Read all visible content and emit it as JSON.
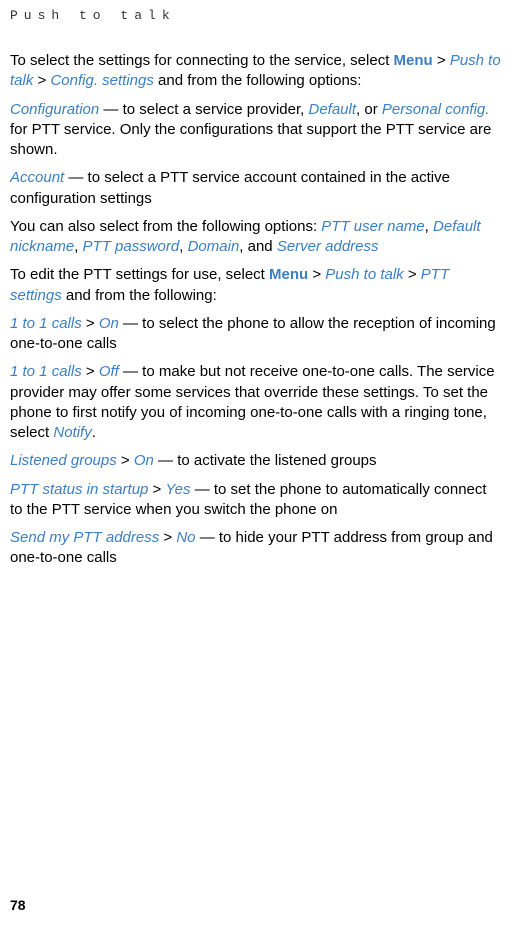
{
  "header": {
    "title": "Push to talk"
  },
  "content": {
    "p1_a": "To select the settings for connecting to the service, select ",
    "p1_menu": "Menu",
    "p1_sep1": " > ",
    "p1_ptt": "Push to talk",
    "p1_sep2": " > ",
    "p1_config": "Config. settings",
    "p1_b": " and from the following options:",
    "p2_config": "Configuration",
    "p2_a": " — to select a service provider, ",
    "p2_default": "Default",
    "p2_b": ", or ",
    "p2_personal": "Personal config.",
    "p2_c": " for PTT service. Only the configurations that support the PTT service are shown.",
    "p3_account": "Account",
    "p3_a": " — to select a PTT service account contained in the active configuration settings",
    "p4_a": "You can also select from the following options: ",
    "p4_username": "PTT user name",
    "p4_sep1": ", ",
    "p4_nickname": "Default nickname",
    "p4_sep2": ", ",
    "p4_password": "PTT password",
    "p4_sep3": ", ",
    "p4_domain": "Domain",
    "p4_sep4": ", and ",
    "p4_server": "Server address",
    "p5_a": "To edit the PTT settings for use, select ",
    "p5_menu": "Menu",
    "p5_sep1": " > ",
    "p5_ptt": "Push to talk",
    "p5_sep2": " > ",
    "p5_settings": "PTT settings",
    "p5_b": " and from the following:",
    "p6_1to1": "1 to 1 calls",
    "p6_sep1": " > ",
    "p6_on": "On",
    "p6_a": " — to select the phone to allow the reception of incoming one-to-one calls",
    "p7_1to1": "1 to 1 calls",
    "p7_sep1": " > ",
    "p7_off": "Off",
    "p7_a": " — to make but not receive one-to-one calls. The service provider may offer some services that override these settings. To set the phone to first notify you of incoming one-to-one calls with a ringing tone, select ",
    "p7_notify": "Notify",
    "p7_b": ".",
    "p8_listened": "Listened groups",
    "p8_sep1": " > ",
    "p8_on": "On",
    "p8_a": " — to activate the listened groups",
    "p9_startup": "PTT status in startup",
    "p9_sep1": " > ",
    "p9_yes": "Yes",
    "p9_a": " — to set the phone to automatically connect to the PTT service when you switch the phone on",
    "p10_send": "Send my PTT address",
    "p10_sep1": " > ",
    "p10_no": "No",
    "p10_a": " — to hide your PTT address from group and one-to-one calls"
  },
  "footer": {
    "page_number": "78"
  }
}
